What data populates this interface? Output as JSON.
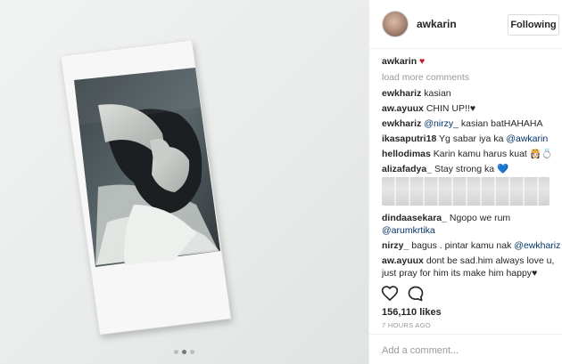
{
  "post": {
    "carousel_count": 3,
    "carousel_active": 1
  },
  "header": {
    "username": "awkarin",
    "follow_label": "Following"
  },
  "caption": {
    "user": "awkarin",
    "emoji": "♥"
  },
  "load_more": "load more comments",
  "comments": [
    {
      "user": "ewkhariz",
      "text": "kasian"
    },
    {
      "user": "aw.ayuux",
      "text": "CHIN UP!!",
      "emoji": "♥"
    },
    {
      "user": "ewkhariz",
      "mention": "@nirzy_",
      "text": "kasian batHAHAHA"
    },
    {
      "user": "ikasaputri18",
      "text": "Yg sabar iya ka",
      "mention": "@awkarin"
    },
    {
      "user": "hellodimas",
      "text": "Karin kamu harus kuat",
      "emoji": "👸🏻💍"
    },
    {
      "user": "alizafadya_",
      "text": "Stay strong ka",
      "emoji": "💙"
    },
    {
      "user": "dindaasekara_",
      "text": "Ngopo we rum",
      "mention": "@arumkrtika"
    },
    {
      "user": "nirzy_",
      "text": "bagus . pintar kamu nak",
      "mention": "@ewkhariz"
    },
    {
      "user": "aw.ayuux",
      "text": "dont be sad.him always love u,",
      "text2": "just pray for him its make him happy",
      "emoji": "♥"
    }
  ],
  "likes": "156,110 likes",
  "time": "7 HOURS AGO",
  "add_comment_placeholder": "Add a comment...",
  "colors": {
    "mention": "#003569",
    "muted": "#999999",
    "heart_red": "#c61a2b",
    "heart_cyan": "#18a8d8"
  },
  "icons": [
    "heart-outline-icon",
    "comment-bubble-icon"
  ]
}
